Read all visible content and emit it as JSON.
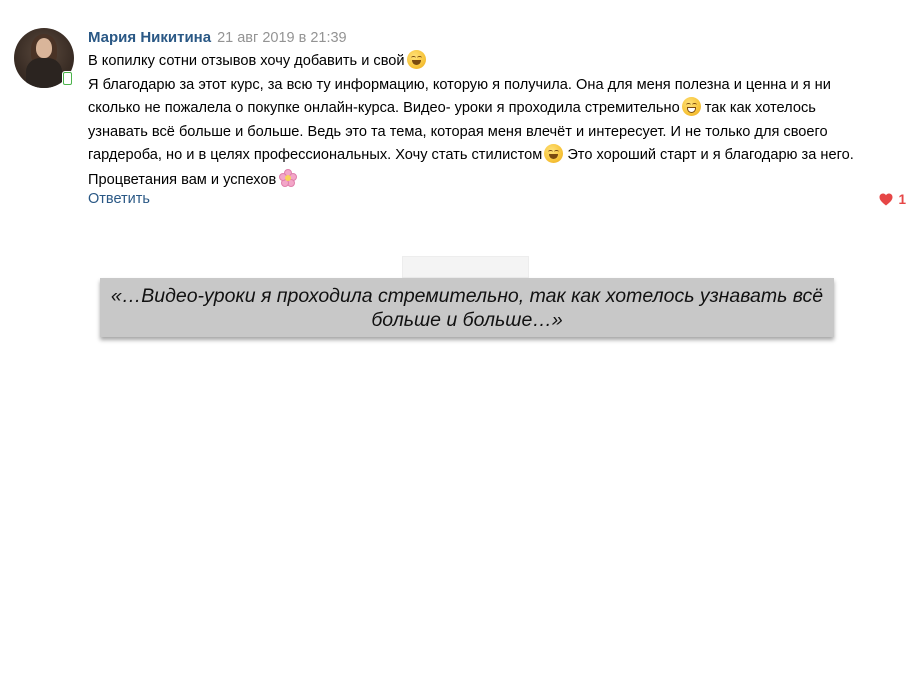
{
  "comment": {
    "author": "Мария Никитина",
    "date": "21 авг 2019 в 21:39",
    "lines": [
      {
        "text": "В копилку сотни отзывов хочу добавить и свой",
        "emoji_after": "smile-emoji"
      },
      {
        "text": "Я благодарю за этот курс, за всю ту информацию, которую я получила. Она для меня полезна и ценна и я ни"
      },
      {
        "text_before": "сколько не пожалела о покупке онлайн-курса. Видео- уроки я проходила стремительно",
        "emoji": "grin-emoji",
        "text_after": " так как хотелось"
      },
      {
        "text": "узнавать всё больше и больше. Ведь это та тема, которая меня влечёт и интересует. И не только для своего"
      },
      {
        "text_before": "гардероба, но и в целях профессиональных. Хочу стать стилистом",
        "emoji": "smile-emoji",
        "text_after": " Это хороший старт и я благодарю за него."
      },
      {
        "text": "Процветания вам и успехов",
        "emoji_after": "flower-emoji"
      }
    ],
    "reply_label": "Ответить",
    "likes_count": "1"
  },
  "quote": {
    "text": "«…Видео-уроки я проходила стремительно, так как хотелось узнавать всё больше и больше…»"
  },
  "colors": {
    "author_link": "#2a5885",
    "date_gray": "#939393",
    "like_red": "#e64646",
    "quote_background": "#c8c8c8",
    "online_mobile_badge": "#4bb34b"
  }
}
